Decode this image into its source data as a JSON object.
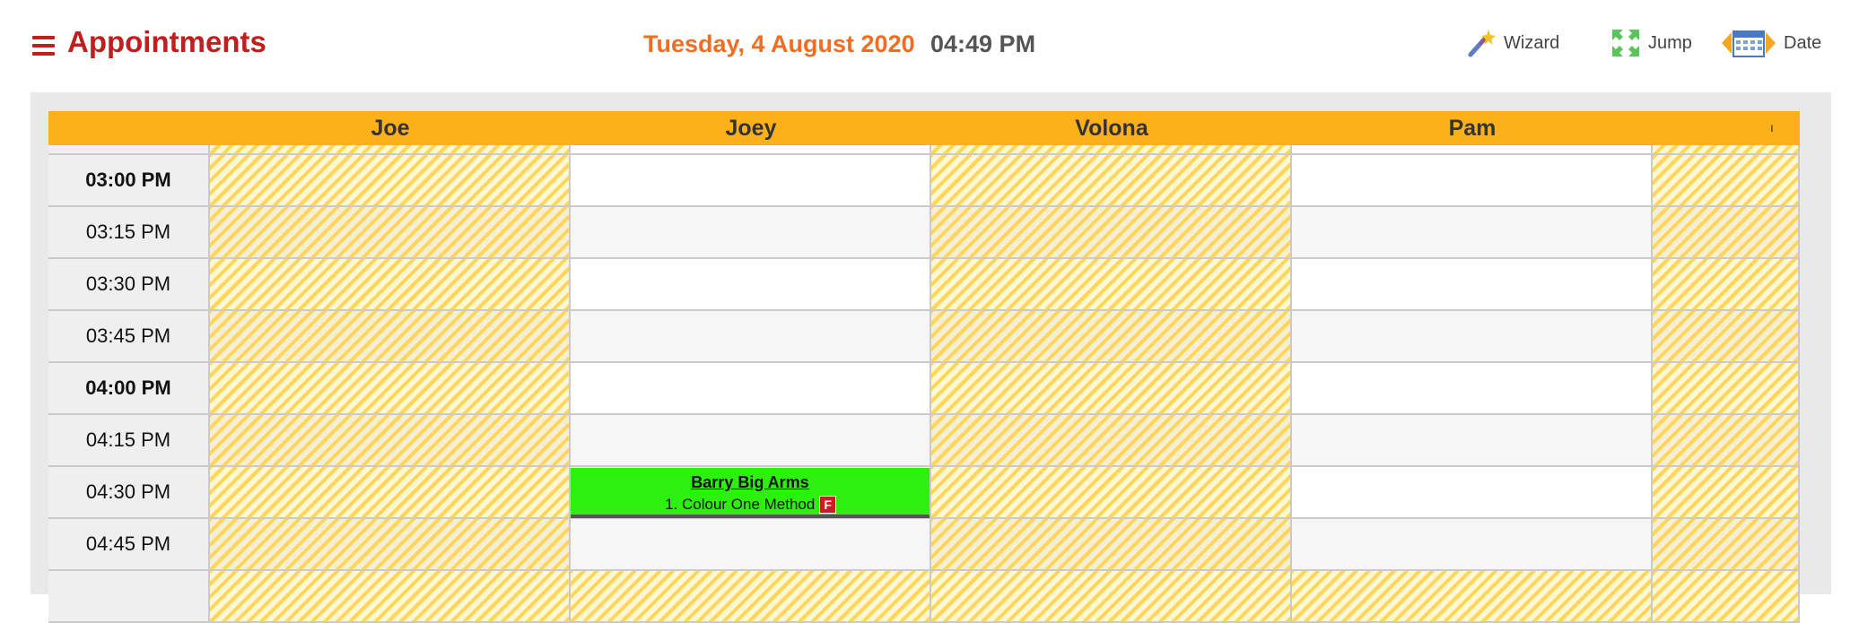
{
  "header": {
    "title": "Appointments",
    "date": "Tuesday, 4 August 2020",
    "time": "04:49 PM",
    "tools": {
      "wizard": "Wizard",
      "jump": "Jump",
      "date": "Date"
    }
  },
  "columns": {
    "staff": [
      "Joe",
      "Joey",
      "Volona",
      "Pam"
    ],
    "overflow_mark": "ı"
  },
  "times": [
    "03:00 PM",
    "03:15 PM",
    "03:30 PM",
    "03:45 PM",
    "04:00 PM",
    "04:15 PM",
    "04:30 PM",
    "04:45 PM"
  ],
  "appointment": {
    "client": "Barry Big Arms",
    "service": "1. Colour One Method",
    "flag": "F",
    "staff": "Joey",
    "time": "04:30 PM",
    "color": "#2ef00e"
  },
  "colors": {
    "brand": "#bf1f1f",
    "date": "#f26c22",
    "column_header": "#fcb11b",
    "closed_stripe": "#ffd65c"
  },
  "icons": {
    "menu": "hamburger-icon",
    "wizard": "magic-wand-icon",
    "jump": "expand-arrows-icon",
    "date": "calendar-icon"
  }
}
